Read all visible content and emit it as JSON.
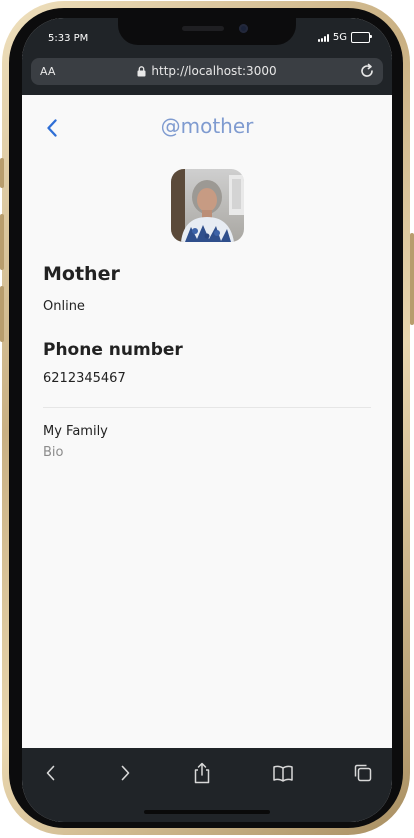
{
  "status": {
    "time": "5:33 PM",
    "network": "5G"
  },
  "browser": {
    "text_size_label": "AA",
    "url": "http://localhost:3000"
  },
  "profile": {
    "handle": "@mother",
    "name": "Mother",
    "presence": "Online",
    "phone_heading": "Phone number",
    "phone_value": "6212345467",
    "bio_value": "My Family",
    "bio_label": "Bio"
  },
  "icons": {
    "back": "chevron-left-icon",
    "lock": "lock-icon",
    "reload": "reload-icon",
    "nav_back": "chevron-left-icon",
    "nav_forward": "chevron-right-icon",
    "share": "share-icon",
    "bookmarks": "book-icon",
    "tabs": "tabs-icon"
  },
  "colors": {
    "accent": "#2f6fd6",
    "title": "#7f9bd0",
    "chrome": "#202428"
  }
}
